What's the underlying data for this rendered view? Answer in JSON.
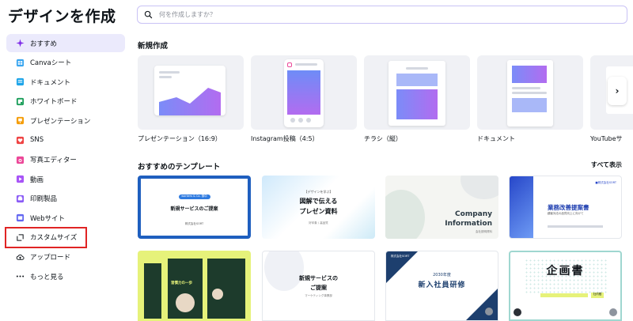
{
  "page": {
    "title": "デザインを作成"
  },
  "search": {
    "placeholder": "何を作成しますか？"
  },
  "sidebar": {
    "items": [
      {
        "label": "おすすめ"
      },
      {
        "label": "Canvaシート"
      },
      {
        "label": "ドキュメント"
      },
      {
        "label": "ホワイトボード"
      },
      {
        "label": "プレゼンテーション"
      },
      {
        "label": "SNS"
      },
      {
        "label": "写真エディター"
      },
      {
        "label": "動画"
      },
      {
        "label": "印刷製品"
      },
      {
        "label": "Webサイト"
      },
      {
        "label": "カスタムサイズ"
      },
      {
        "label": "アップロード"
      },
      {
        "label": "もっと見る"
      }
    ]
  },
  "new_section": {
    "title": "新規作成",
    "types": [
      {
        "label": "プレゼンテーション（16:9）"
      },
      {
        "label": "Instagram投稿（4:5）"
      },
      {
        "label": "チラシ（縦）"
      },
      {
        "label": "ドキュメント"
      },
      {
        "label": "YouTubeサ"
      }
    ],
    "next_arrow": "›"
  },
  "templates_section": {
    "title": "おすすめのテンプレート",
    "see_all": "すべて表示",
    "templates": [
      {
        "badge": "workers & Co. 御中",
        "title": "新規サービスのご提案",
        "sub": "株式会社SORT"
      },
      {
        "tag": "【デザインを学ぶ】",
        "line1": "図解で伝える",
        "line2": "プレゼン資料",
        "sub": "好印象 / 高品質"
      },
      {
        "line1": "Company",
        "line2": "Information",
        "sub": "会社説明資料"
      },
      {
        "brand": "■株式会社SORT",
        "title": "業務改善提案書",
        "sub": "顧客対応の品質向上に向けて"
      },
      {
        "text": "習慣力の一歩"
      },
      {
        "title": "新規サービスの",
        "title2": "ご提案",
        "sub": "マーケティング事業部"
      },
      {
        "brand": "株式会社SORT",
        "year": "2030年度",
        "title": "新入社員研修"
      },
      {
        "title": "企画書",
        "badge": "社内限"
      }
    ]
  },
  "colors": {
    "accent": "#7d2ae8",
    "active_bg": "#ebeafc",
    "highlight": "#e02424"
  }
}
